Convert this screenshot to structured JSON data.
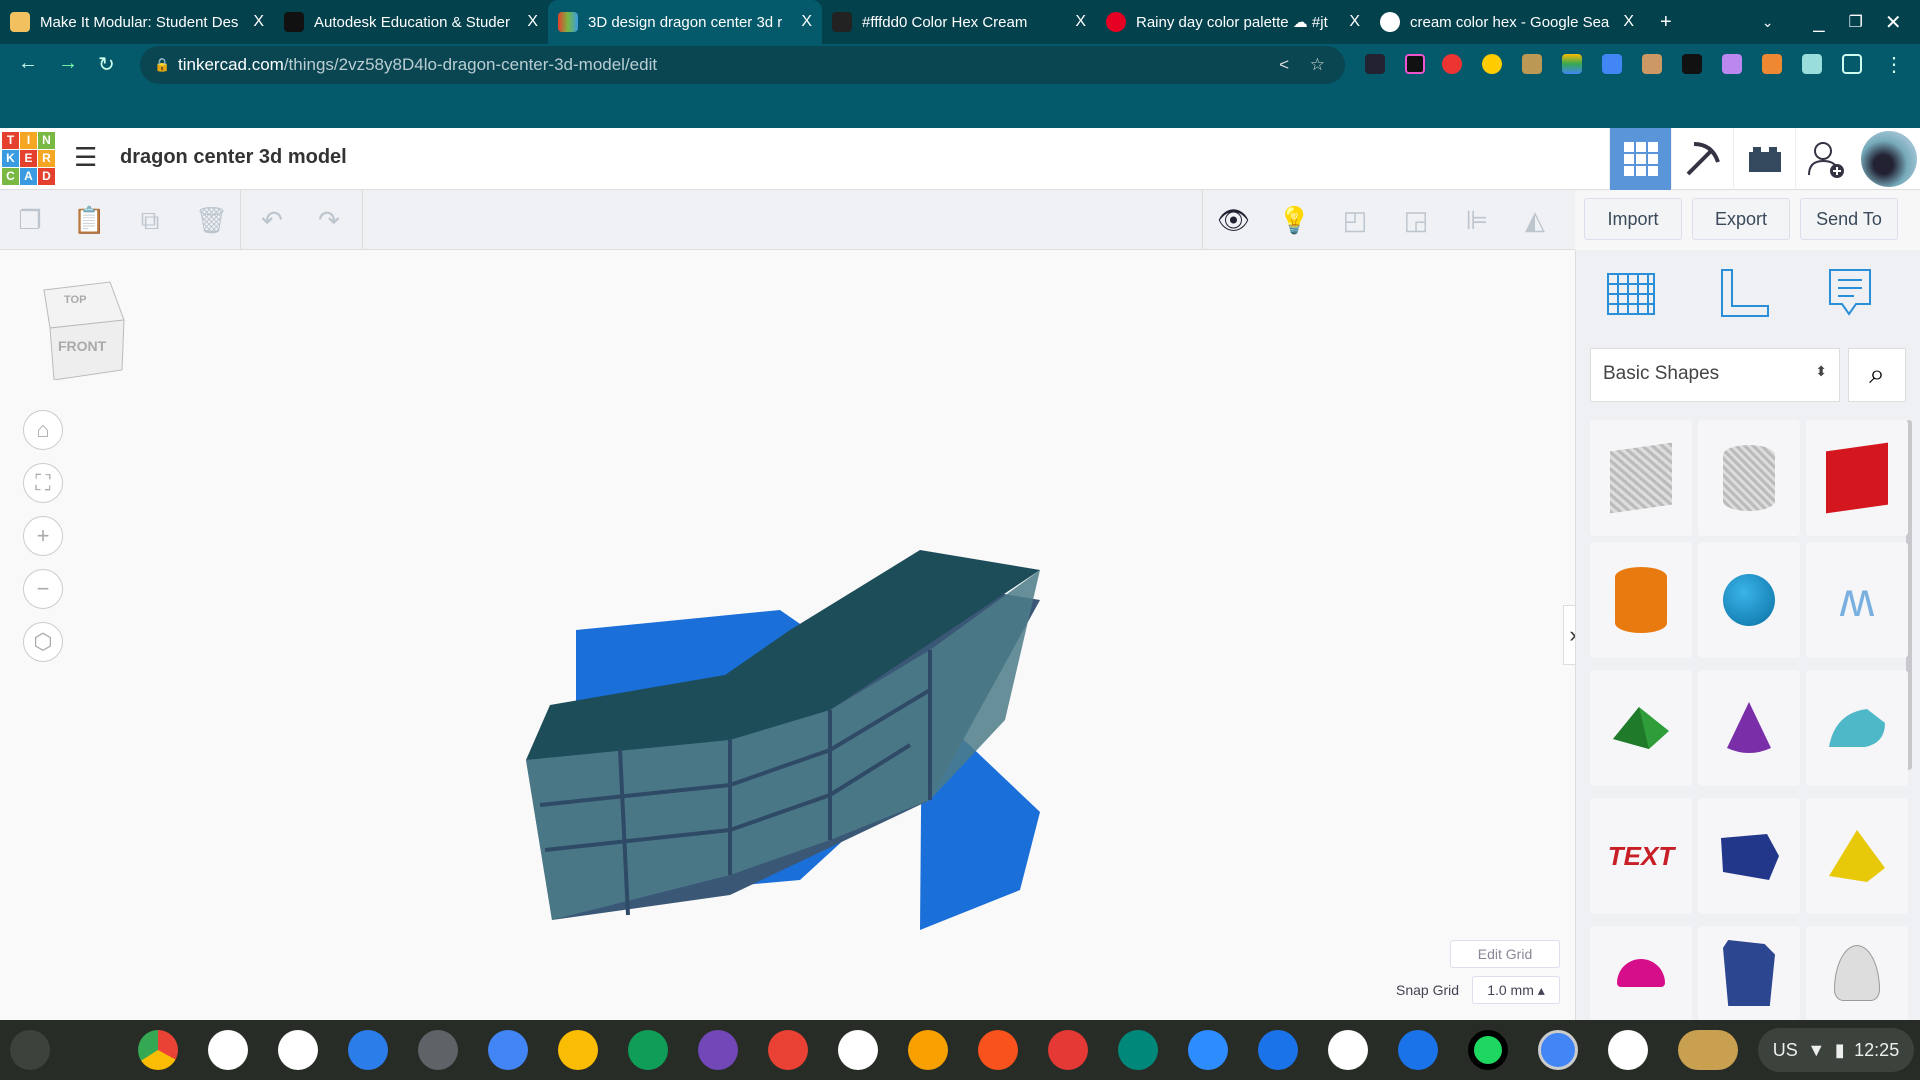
{
  "browser": {
    "tabs": [
      {
        "title": "Make It Modular: Student Des",
        "color": "#f3c060"
      },
      {
        "title": "Autodesk Education & Studer",
        "color": "#111"
      },
      {
        "title": "3D design dragon center 3d r",
        "color": "#e5402e",
        "active": true
      },
      {
        "title": "#fffdd0 Color Hex Cream",
        "color": "#222"
      },
      {
        "title": "Rainy day color palette ☁ #jt",
        "color": "#e60023"
      },
      {
        "title": "cream color hex - Google Sea",
        "color": "#4285f4"
      }
    ],
    "url_host": "tinkercad.com",
    "url_path": "/things/2vz58y8D4lo-dragon-center-3d-model/edit",
    "close_glyph": "X",
    "new_tab": "+"
  },
  "tinkercad": {
    "logo": [
      "T",
      "I",
      "N",
      "K",
      "E",
      "R",
      "C",
      "A",
      "D"
    ],
    "logo_colors": [
      "#e5402e",
      "#f5a623",
      "#78b843",
      "#3b9be0",
      "#e5402e",
      "#f5a623",
      "#78b843",
      "#3b9be0",
      "#e5402e"
    ],
    "design_title": "dragon center 3d model",
    "import": "Import",
    "export": "Export",
    "send_to": "Send To",
    "view_cube": {
      "top": "TOP",
      "front": "FRONT"
    },
    "edit_grid": "Edit Grid",
    "snap_grid_label": "Snap Grid",
    "snap_grid_value": "1.0 mm",
    "shape_category": "Basic Shapes",
    "shapes": [
      "Box",
      "Cylinder",
      "Box Red",
      "Cylinder Orange",
      "Sphere",
      "Scribble",
      "Roof",
      "Cone",
      "Round Roof",
      "Text",
      "Polygon",
      "Pyramid",
      "Half Sphere",
      "Hexagonal Prism",
      "Paraboloid"
    ],
    "accent": "#5b95d9"
  },
  "taskbar": {
    "lang": "US",
    "time": "12:25"
  }
}
